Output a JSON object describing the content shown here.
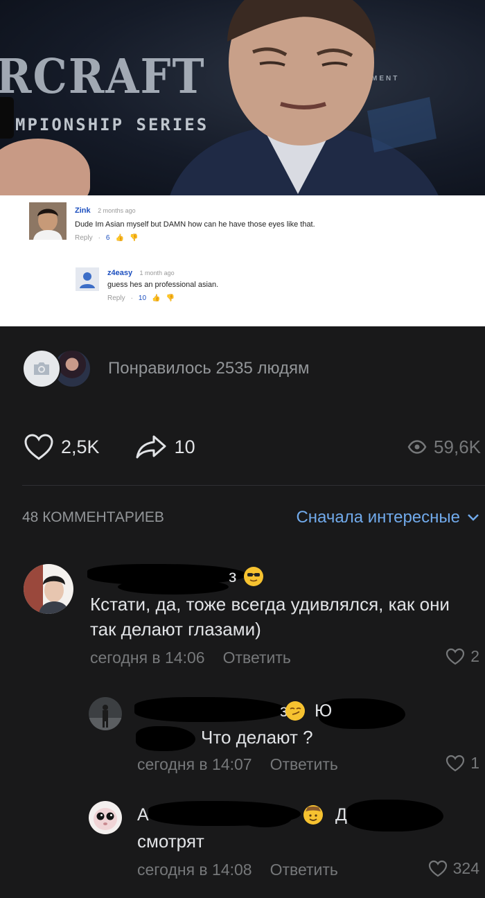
{
  "post_image": {
    "photo_texts": {
      "logo": "RCRAFT",
      "series": "MPIONSHIP SERIES",
      "side": "MENT"
    },
    "youtube_comments": [
      {
        "author": "Zink",
        "time": "2 months ago",
        "text": "Dude Im Asian myself but DAMN how can he have those eyes like that.",
        "reply_label": "Reply",
        "likes": "6"
      },
      {
        "author": "z4easy",
        "time": "1 month ago",
        "text": "guess hes an professional asian.",
        "reply_label": "Reply",
        "likes": "10"
      }
    ]
  },
  "likes_summary": {
    "text": "Понравилось 2535 людям",
    "icon": "camera-icon"
  },
  "actions": {
    "like_count": "2,5K",
    "share_count": "10",
    "views": "59,6K"
  },
  "comments_header": {
    "count_label": "48 КОММЕНТАРИЕВ",
    "sort_label": "Сначала интересные"
  },
  "comments": [
    {
      "text": "Кстати, да, тоже всегда удивлялся, как они так делают глазами)",
      "time": "сегодня в 14:06",
      "reply_label": "Ответить",
      "likes": "2",
      "name_suffix": "з",
      "emoji": "sunglasses-emoji"
    },
    {
      "text": "Что делают ?",
      "time": "сегодня в 14:07",
      "reply_label": "Ответить",
      "likes": "1",
      "name_suffix": "з",
      "name_suffix2": "Ю",
      "emoji": "smirk-emoji"
    },
    {
      "text": "смотрят",
      "time": "сегодня в 14:08",
      "reply_label": "Ответить",
      "likes": "324",
      "name_prefix": "А",
      "name_suffix": "Д",
      "emoji": "cowboy-emoji"
    }
  ],
  "colors": {
    "background": "#19191a",
    "accent": "#71aaeb",
    "secondary_text": "#76787a"
  }
}
